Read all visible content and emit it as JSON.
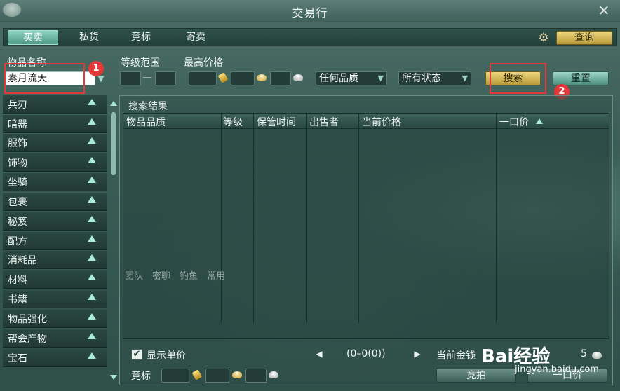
{
  "window": {
    "title": "交易行"
  },
  "tabs": [
    {
      "label": "买卖",
      "active": true
    },
    {
      "label": "私货"
    },
    {
      "label": "竞标"
    },
    {
      "label": "寄卖"
    }
  ],
  "toolbar": {
    "gear_icon": "gear-icon",
    "query_label": "查询"
  },
  "filters": {
    "item_name_label": "物品名称",
    "item_name_value": "素月流天",
    "level_range_label": "等级范围",
    "level_sep": "—",
    "max_price_label": "最高价格",
    "quality_select": "任何品质",
    "status_select": "所有状态",
    "search_label": "搜索",
    "reset_label": "重置"
  },
  "annotations": {
    "badge1": "1",
    "badge2": "2",
    "color": "#e23a3a"
  },
  "categories": [
    "兵刃",
    "暗器",
    "服饰",
    "饰物",
    "坐骑",
    "包裹",
    "秘笈",
    "配方",
    "消耗品",
    "材料",
    "书籍",
    "物品强化",
    "帮会产物",
    "宝石"
  ],
  "results": {
    "title": "搜索结果",
    "columns": [
      "物品品质",
      "等级",
      "保管时间",
      "出售者",
      "当前价格",
      "一口价"
    ]
  },
  "footer": {
    "show_unit_price": "显示单价",
    "pager": "(0–0(0))",
    "current_money_label": "当前金钱",
    "money_tail": "5",
    "bid_label": "竞标",
    "bid_button": "竞拍",
    "buyout_button": "一口价"
  },
  "watermark": {
    "logo": "Bai经验",
    "site": "jingyan.baidu.com"
  },
  "colors": {
    "accent_gold": "#ecd67c",
    "accent_teal": "#8fd2c2",
    "panel": "#2f4f49"
  }
}
